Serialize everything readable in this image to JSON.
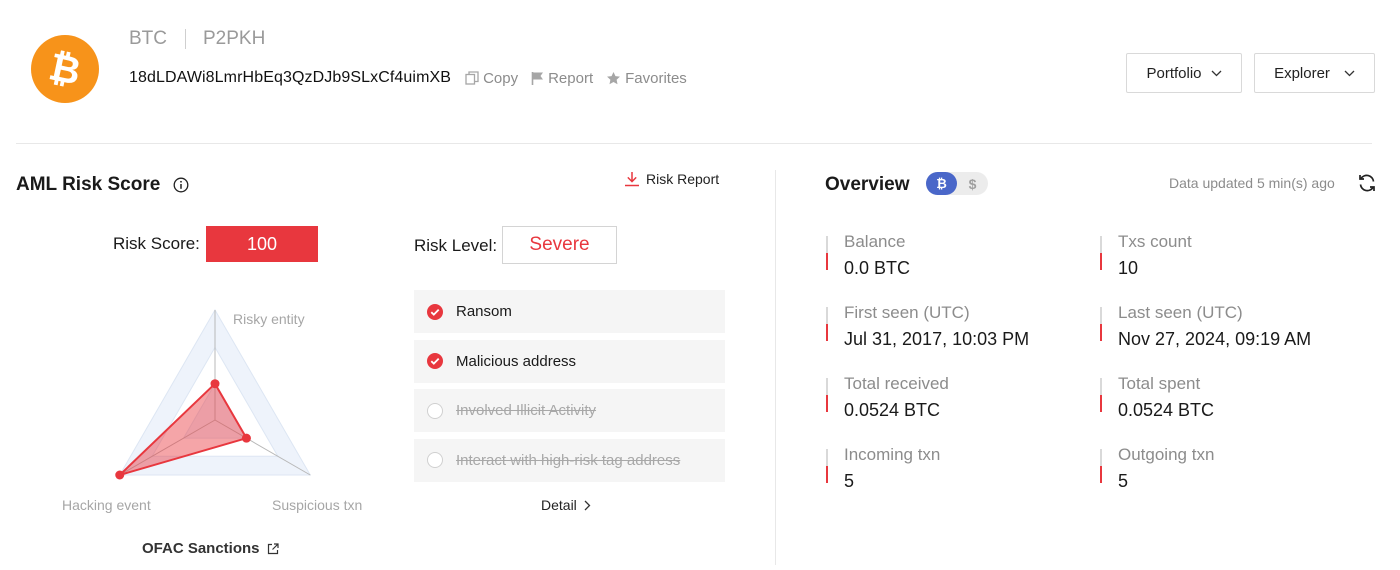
{
  "header": {
    "chain": "BTC",
    "address_type": "P2PKH",
    "address": "18dLDAWi8LmrHbEq3QzDJb9SLxCf4uimXB",
    "actions": {
      "copy": "Copy",
      "report": "Report",
      "favorites": "Favorites"
    },
    "buttons": {
      "portfolio": "Portfolio",
      "explorer": "Explorer"
    },
    "logo_icon": "bitcoin-icon",
    "logo_color": "#f7931a"
  },
  "aml": {
    "title": "AML Risk Score",
    "risk_report": "Risk Report",
    "risk_score_label": "Risk Score:",
    "risk_score": "100",
    "risk_level_label": "Risk Level:",
    "risk_level": "Severe",
    "accent_color": "#e8373e",
    "radar": {
      "axes": [
        "Risky entity",
        "Suspicious txn",
        "Hacking event"
      ],
      "values": [
        0.33,
        0.33,
        1.0
      ]
    },
    "ofac_label": "OFAC Sanctions",
    "tags": [
      {
        "label": "Ransom",
        "checked": true
      },
      {
        "label": "Malicious address",
        "checked": true
      },
      {
        "label": "Involved Illicit Activity",
        "checked": false
      },
      {
        "label": "Interact with high-risk tag address",
        "checked": false
      }
    ],
    "detail_label": "Detail"
  },
  "overview": {
    "title": "Overview",
    "toggle": {
      "btc_symbol": "₿",
      "usd_symbol": "$"
    },
    "updated": "Data updated 5 min(s) ago",
    "stats": [
      {
        "label": "Balance",
        "value": "0.0 BTC"
      },
      {
        "label": "Txs count",
        "value": "10"
      },
      {
        "label": "First seen (UTC)",
        "value": "Jul 31, 2017, 10:03 PM"
      },
      {
        "label": "Last seen (UTC)",
        "value": "Nov 27, 2024, 09:19 AM"
      },
      {
        "label": "Total received",
        "value": "0.0524 BTC"
      },
      {
        "label": "Total spent",
        "value": "0.0524 BTC"
      },
      {
        "label": "Incoming txn",
        "value": "5"
      },
      {
        "label": "Outgoing txn",
        "value": "5"
      }
    ]
  }
}
